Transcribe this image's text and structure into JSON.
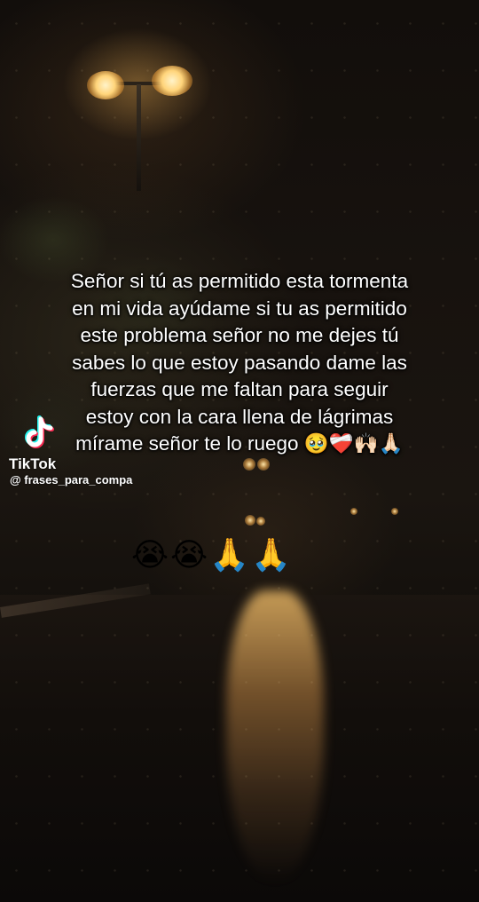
{
  "caption": {
    "lines": [
      "Señor si tú as permitido esta tormenta",
      "en mi vida ayúdame si tu as permitido",
      "este problema señor no me dejes tú",
      "sabes lo que estoy pasando dame las",
      "fuerzas que me faltan para seguir",
      "estoy con la cara llena de lágrimas",
      "mírame señor te lo ruego 🥹❤️‍🩹🙌🏻🙏🏻"
    ]
  },
  "emojis": "😭😭🙏🙏",
  "watermark": {
    "brand": "TikTok",
    "handle": "@ frases_para_compa",
    "icon": "tiktok-logo-icon"
  },
  "colors": {
    "text": "#ffffff",
    "tiktok_cyan": "#25f4ee",
    "tiktok_red": "#fe2c55"
  }
}
